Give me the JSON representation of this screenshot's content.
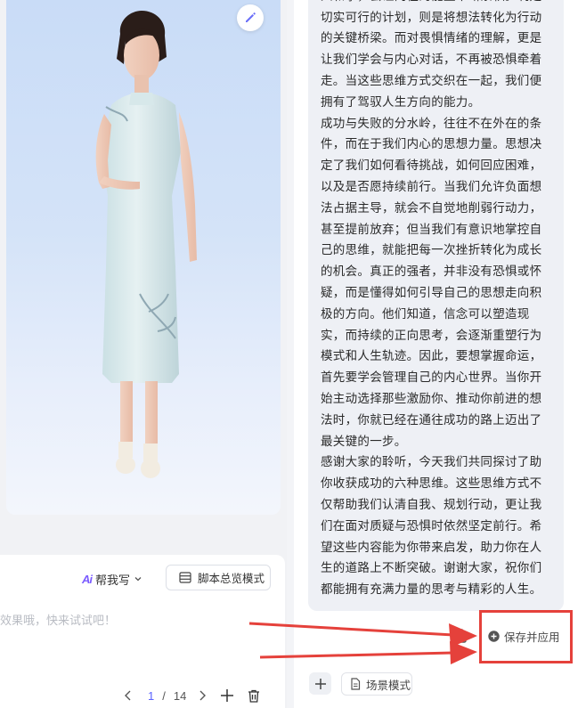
{
  "left_panel": {
    "help_write": {
      "ai": "Ai",
      "label": "帮我写"
    },
    "overview_label": "脚本总览模式",
    "hint": "效果哦，快来试试吧！",
    "pager": {
      "current": "1",
      "sep": "/",
      "total": "14"
    }
  },
  "right_panel": {
    "paragraphs": [
      "积极的心态，主动选择那些能滋养心灵的人和事，会让内在的能量不断累积。制定切实可行的计划，则是将想法转化为行动的关键桥梁。而对畏惧情绪的理解，更是让我们学会与内心对话，不再被恐惧牵着走。当这些思维方式交织在一起，我们便拥有了驾驭人生方向的能力。",
      "成功与失败的分水岭，往往不在外在的条件，而在于我们内心的思想力量。思想决定了我们如何看待挑战，如何回应困难，以及是否愿持续前行。当我们允许负面想法占据主导，就会不自觉地削弱行动力，甚至提前放弃；但当我们有意识地掌控自己的思维，就能把每一次挫折转化为成长的机会。真正的强者，并非没有恐惧或怀疑，而是懂得如何引导自己的思想走向积极的方向。他们知道，信念可以塑造现实，而持续的正向思考，会逐渐重塑行为模式和人生轨迹。因此，要想掌握命运，首先要学会管理自己的内心世界。当你开始主动选择那些激励你、推动你前进的想法时，你就已经在通往成功的路上迈出了最关键的一步。",
      "感谢大家的聆听，今天我们共同探讨了助你收获成功的六种思维。这些思维方式不仅帮助我们认清自我、规划行动，更让我们在面对质疑与恐惧时依然坚定前行。希望这些内容能为你带来启发，助力你在人生的道路上不断突破。谢谢大家，祝你们都能拥有充满力量的思考与精彩的人生。"
    ],
    "save_apply_label": "保存并应用",
    "scene_mode_label": "场景模式"
  },
  "colors": {
    "accent": "#5b63ff",
    "highlight_red": "#e5413b",
    "bubble_bg": "#eef0f5"
  }
}
